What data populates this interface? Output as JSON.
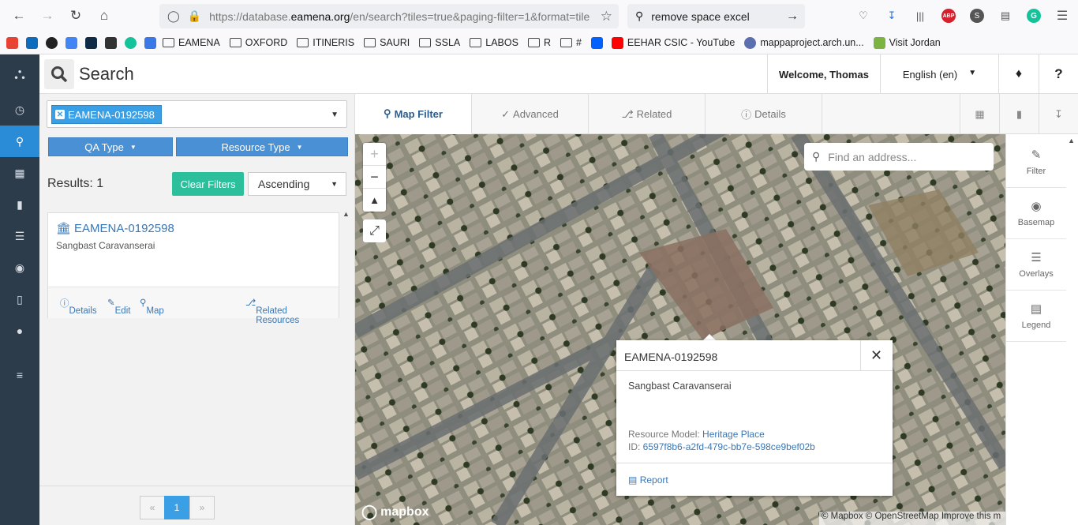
{
  "browser": {
    "url_prefix": "https://database.",
    "url_domain": "eamena.org",
    "url_path": "/en/search?tiles=true&paging-filter=1&format=tile",
    "search_value": "remove space excel",
    "bookmarks": [
      "EAMENA",
      "OXFORD",
      "ITINERIS",
      "SAURI",
      "SSLA",
      "LABOS",
      "R",
      "#",
      "EEHAR CSIC - YouTube",
      "mappaproject.arch.un...",
      "Visit Jordan"
    ],
    "ext_abp": "ABP",
    "ext_s": "S",
    "ext_g": "G",
    "ext_g2": "G"
  },
  "header": {
    "title": "Search",
    "welcome": "Welcome, Thomas",
    "language": "English (en)",
    "help": "?"
  },
  "left": {
    "selected_tag": "EAMENA-0192598",
    "qa_type": "QA Type",
    "resource_type": "Resource Type",
    "results": "Results: 1",
    "clear_filters": "Clear Filters",
    "sort": "Ascending",
    "card": {
      "title": "EAMENA-0192598",
      "subtitle": "Sangbast Caravanserai",
      "details": "Details",
      "edit": "Edit",
      "map": "Map",
      "related": "Related Resources"
    },
    "pager": {
      "prev": "«",
      "current": "1",
      "next": "»"
    }
  },
  "tabs": [
    "Map Filter",
    "Advanced",
    "Related",
    "Details"
  ],
  "map": {
    "address_placeholder": "Find an address...",
    "popup": {
      "title": "EAMENA-0192598",
      "name": "Sangbast Caravanserai",
      "model_label": "Resource Model: ",
      "model_value": "Heritage Place",
      "id_label": "ID: ",
      "id_value": "6597f8b6-a2fd-479c-bb7e-598ce9bef02b",
      "report": "Report"
    },
    "logo": "mapbox",
    "attribution": "© Mapbox © OpenStreetMap  Improve this m"
  },
  "right_panel": [
    "Filter",
    "Basemap",
    "Overlays",
    "Legend"
  ],
  "colors": {
    "sidebar": "#2d3c4b",
    "accent": "#2a8bd6",
    "clear": "#2cbf9b",
    "link": "#3a77b5"
  }
}
